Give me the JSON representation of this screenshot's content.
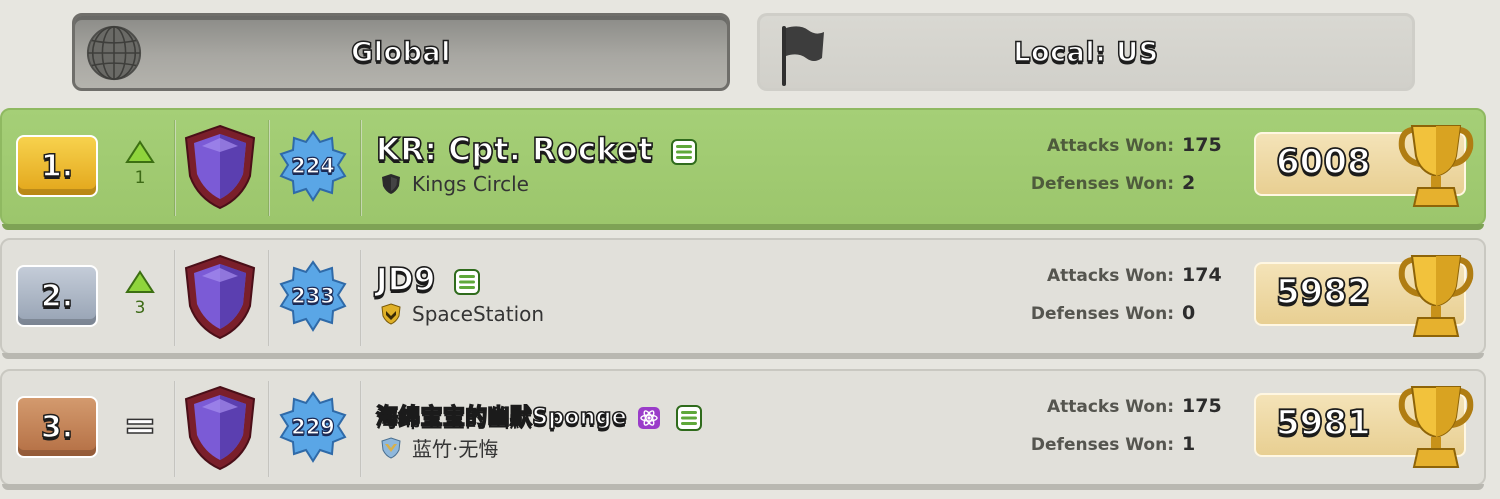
{
  "tabs": {
    "global": {
      "label": "Global",
      "icon": "globe-icon",
      "selected": true
    },
    "local": {
      "label": "Local: US",
      "icon": "flag-icon",
      "selected": false
    }
  },
  "rows": [
    {
      "rank": "1.",
      "change": {
        "direction": "up",
        "value": "1"
      },
      "level": "224",
      "name": "KR: Cpt. Rocket",
      "clan": "Kings Circle",
      "attacks_label": "Attacks Won:",
      "attacks_won": "175",
      "defenses_label": "Defenses Won:",
      "defenses_won": "2",
      "trophies": "6008"
    },
    {
      "rank": "2.",
      "change": {
        "direction": "up",
        "value": "3"
      },
      "level": "233",
      "name": "JD9",
      "clan": "SpaceStation",
      "attacks_label": "Attacks Won:",
      "attacks_won": "174",
      "defenses_label": "Defenses Won:",
      "defenses_won": "0",
      "trophies": "5982"
    },
    {
      "rank": "3.",
      "change": {
        "direction": "same",
        "value": "="
      },
      "level": "229",
      "name": "海绵宝宝的幽默Sponge",
      "clan": "蓝竹·无悔",
      "attacks_label": "Attacks Won:",
      "attacks_won": "175",
      "defenses_label": "Defenses Won:",
      "defenses_won": "1",
      "trophies": "5981"
    }
  ],
  "colors": {
    "highlight_row": "#a5cf77",
    "row_bg": "#e1e0da",
    "gold_rank": "#f7d24d",
    "silver_rank": "#c4ccd8",
    "bronze_rank": "#d39a6e",
    "trophy_box": "#f4e3b8"
  }
}
